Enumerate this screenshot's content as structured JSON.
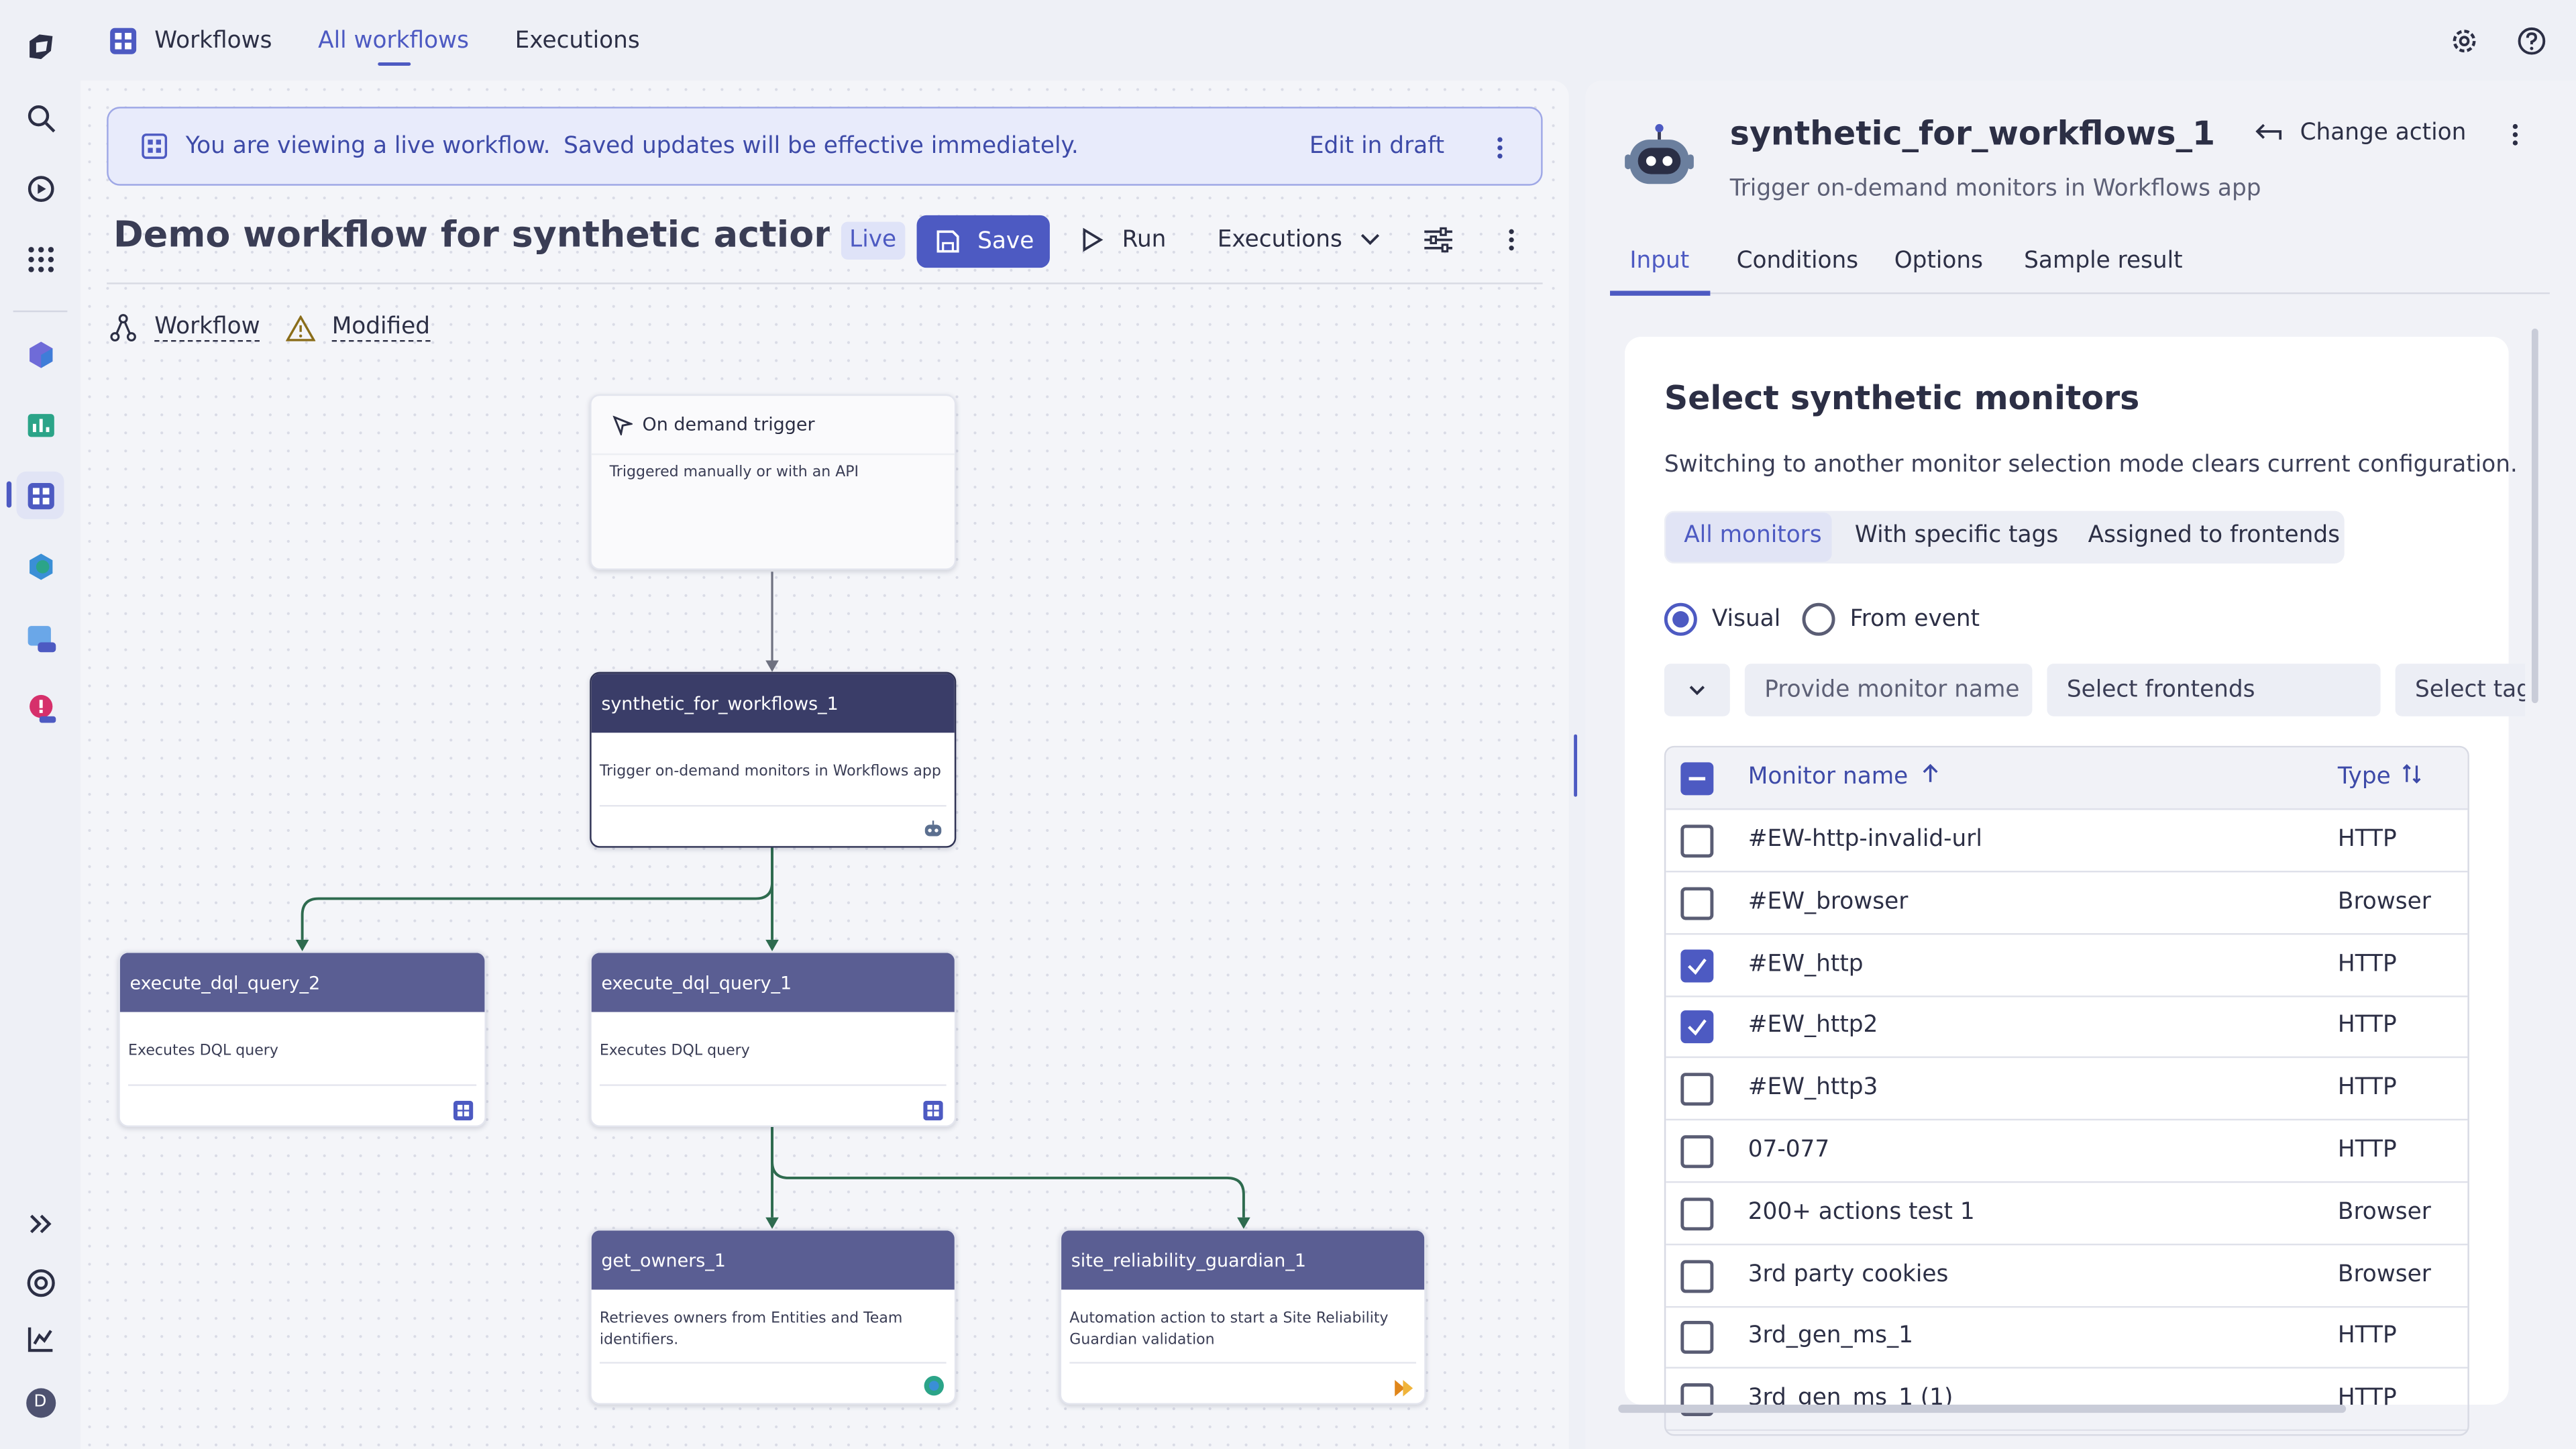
{
  "nav": {
    "tabs": [
      {
        "label": "Workflows"
      },
      {
        "label": "All workflows"
      },
      {
        "label": "Executions"
      }
    ]
  },
  "banner": {
    "text": "You are viewing a live workflow.",
    "sub": "Saved updates will be effective immediately.",
    "action": "Edit in draft"
  },
  "workflow": {
    "title": "Demo workflow for synthetic action...",
    "status": "Live",
    "save": "Save",
    "run": "Run",
    "executions": "Executions",
    "crumb_workflow": "Workflow",
    "crumb_modified": "Modified"
  },
  "nodes": [
    {
      "title": "On demand trigger",
      "desc": "Triggered manually or with an API"
    },
    {
      "title": "synthetic_for_workflows_1",
      "desc": "Trigger on-demand monitors in Workflows app"
    },
    {
      "title": "execute_dql_query_2",
      "desc": "Executes DQL query"
    },
    {
      "title": "execute_dql_query_1",
      "desc": "Executes DQL query"
    },
    {
      "title": "get_owners_1",
      "desc": "Retrieves owners from Entities and Team identifiers."
    },
    {
      "title": "site_reliability_guardian_1",
      "desc": "Automation action to start a Site Reliability Guardian validation"
    }
  ],
  "panel": {
    "title": "synthetic_for_workflows_1",
    "subtitle": "Trigger on-demand monitors in Workflows app",
    "change": "Change action",
    "tabs": [
      "Input",
      "Conditions",
      "Options",
      "Sample result"
    ],
    "section": "Select synthetic monitors",
    "hint": "Switching to another monitor selection mode clears current configuration.",
    "modes": [
      "All monitors",
      "With specific tags",
      "Assigned to frontends"
    ],
    "radio_visual": "Visual",
    "radio_event": "From event",
    "name_placeholder": "Provide monitor name",
    "frontends": "Select frontends",
    "tags": "Select tag",
    "col_name": "Monitor name",
    "col_type": "Type"
  },
  "monitors": [
    {
      "name": "#EW-http-invalid-url",
      "type": "HTTP",
      "checked": false
    },
    {
      "name": "#EW_browser",
      "type": "Browser",
      "checked": false
    },
    {
      "name": "#EW_http",
      "type": "HTTP",
      "checked": true
    },
    {
      "name": "#EW_http2",
      "type": "HTTP",
      "checked": true
    },
    {
      "name": "#EW_http3",
      "type": "HTTP",
      "checked": false
    },
    {
      "name": "07-077",
      "type": "HTTP",
      "checked": false
    },
    {
      "name": "200+ actions test 1",
      "type": "Browser",
      "checked": false
    },
    {
      "name": "3rd party cookies",
      "type": "Browser",
      "checked": false
    },
    {
      "name": "3rd_gen_ms_1",
      "type": "HTTP",
      "checked": false
    },
    {
      "name": "3rd_gen_ms_1 (1)",
      "type": "HTTP",
      "checked": false
    }
  ],
  "colors": {
    "accent": "#4d5ac2",
    "node_header": "#5a5e93",
    "edge": "#2e6b4f"
  }
}
